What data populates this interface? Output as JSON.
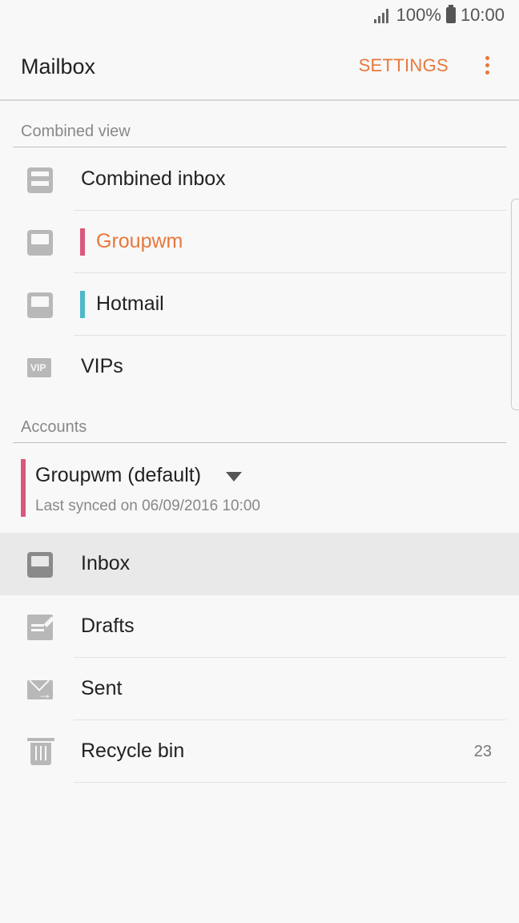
{
  "status_bar": {
    "battery": "100%",
    "time": "10:00"
  },
  "app_bar": {
    "title": "Mailbox",
    "settings_label": "SETTINGS"
  },
  "combined_view": {
    "header": "Combined view",
    "items": [
      {
        "label": "Combined inbox",
        "icon": "combined-inbox-icon"
      },
      {
        "label": "Groupwm",
        "icon": "inbox-tray-icon",
        "bar_color": "#d9587b",
        "text_color": "#e8773b"
      },
      {
        "label": "Hotmail",
        "icon": "inbox-tray-icon",
        "bar_color": "#4fb8c9"
      },
      {
        "label": "VIPs",
        "icon": "vip-folder-icon",
        "icon_text": "VIP"
      }
    ]
  },
  "accounts": {
    "header": "Accounts",
    "account_name": "Groupwm (default)",
    "last_synced": "Last synced on 06/09/2016  10:00",
    "folders": [
      {
        "label": "Inbox",
        "icon": "inbox-tray-icon",
        "selected": true
      },
      {
        "label": "Drafts",
        "icon": "drafts-icon"
      },
      {
        "label": "Sent",
        "icon": "sent-icon"
      },
      {
        "label": "Recycle bin",
        "icon": "trash-icon",
        "count": "23"
      }
    ]
  },
  "colors": {
    "accent": "#e8773b",
    "groupwm": "#d9587b",
    "hotmail": "#4fb8c9"
  }
}
